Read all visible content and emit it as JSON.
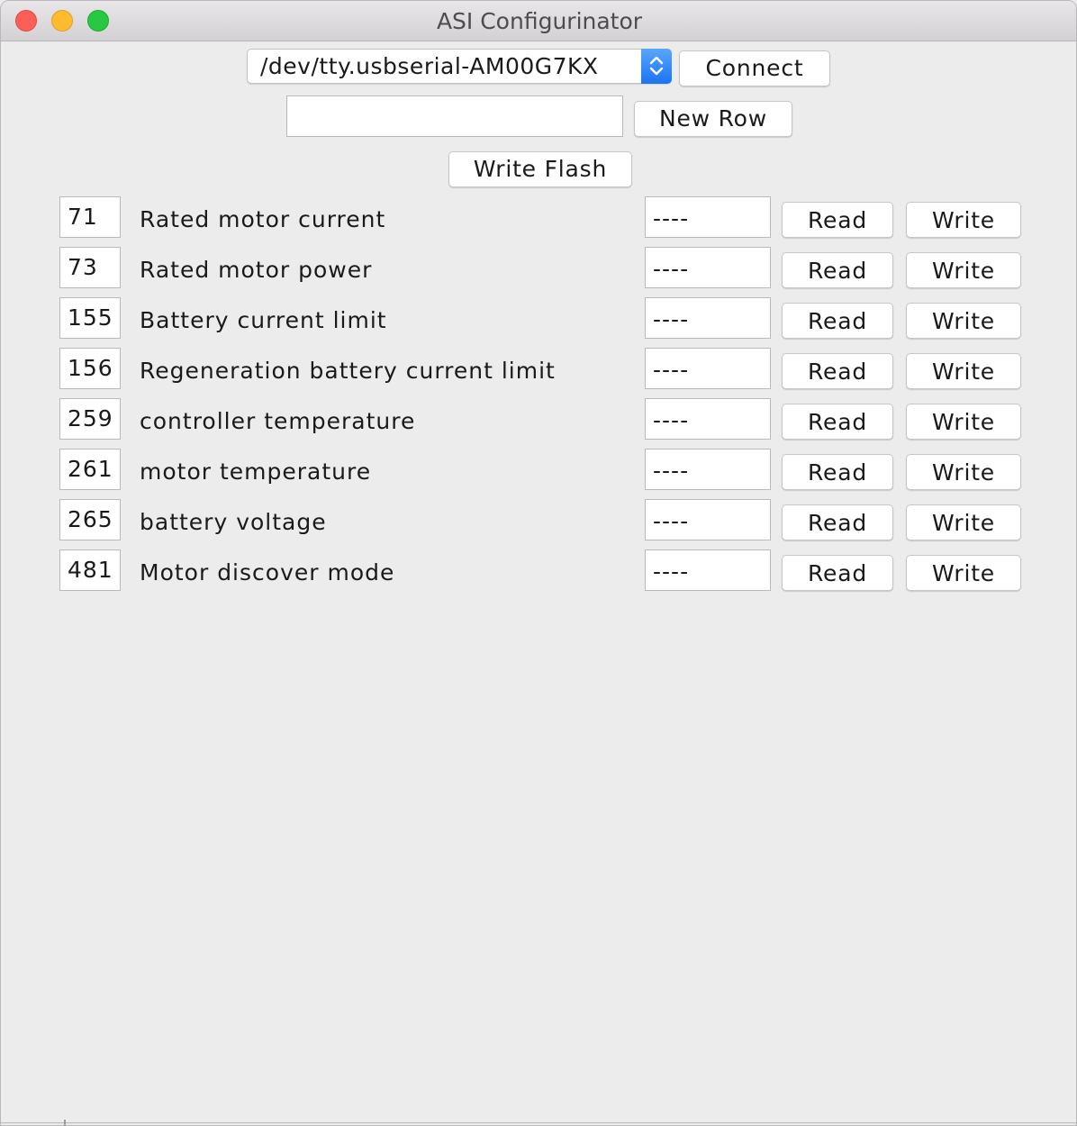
{
  "window": {
    "title": "ASI Configurinator"
  },
  "toolbar": {
    "port_selected": "/dev/tty.usbserial-AM00G7KX",
    "connect_label": "Connect",
    "new_row_value": "",
    "new_row_label": "New Row",
    "write_flash_label": "Write Flash"
  },
  "rows": [
    {
      "address": "71",
      "name": "Rated motor current",
      "value": "----",
      "read_label": "Read",
      "write_label": "Write"
    },
    {
      "address": "73",
      "name": "Rated motor power",
      "value": "----",
      "read_label": "Read",
      "write_label": "Write"
    },
    {
      "address": "155",
      "name": "Battery current limit",
      "value": "----",
      "read_label": "Read",
      "write_label": "Write"
    },
    {
      "address": "156",
      "name": "Regeneration battery current limit",
      "value": "----",
      "read_label": "Read",
      "write_label": "Write"
    },
    {
      "address": "259",
      "name": "controller temperature",
      "value": "----",
      "read_label": "Read",
      "write_label": "Write"
    },
    {
      "address": "261",
      "name": "motor temperature",
      "value": "----",
      "read_label": "Read",
      "write_label": "Write"
    },
    {
      "address": "265",
      "name": "battery voltage",
      "value": "----",
      "read_label": "Read",
      "write_label": "Write"
    },
    {
      "address": "481",
      "name": "Motor discover mode",
      "value": "----",
      "read_label": "Read",
      "write_label": "Write"
    }
  ],
  "colors": {
    "close": "#fc5f57",
    "minimize": "#fdbc2e",
    "maximize": "#28c840",
    "accent": "#1b73f2"
  }
}
